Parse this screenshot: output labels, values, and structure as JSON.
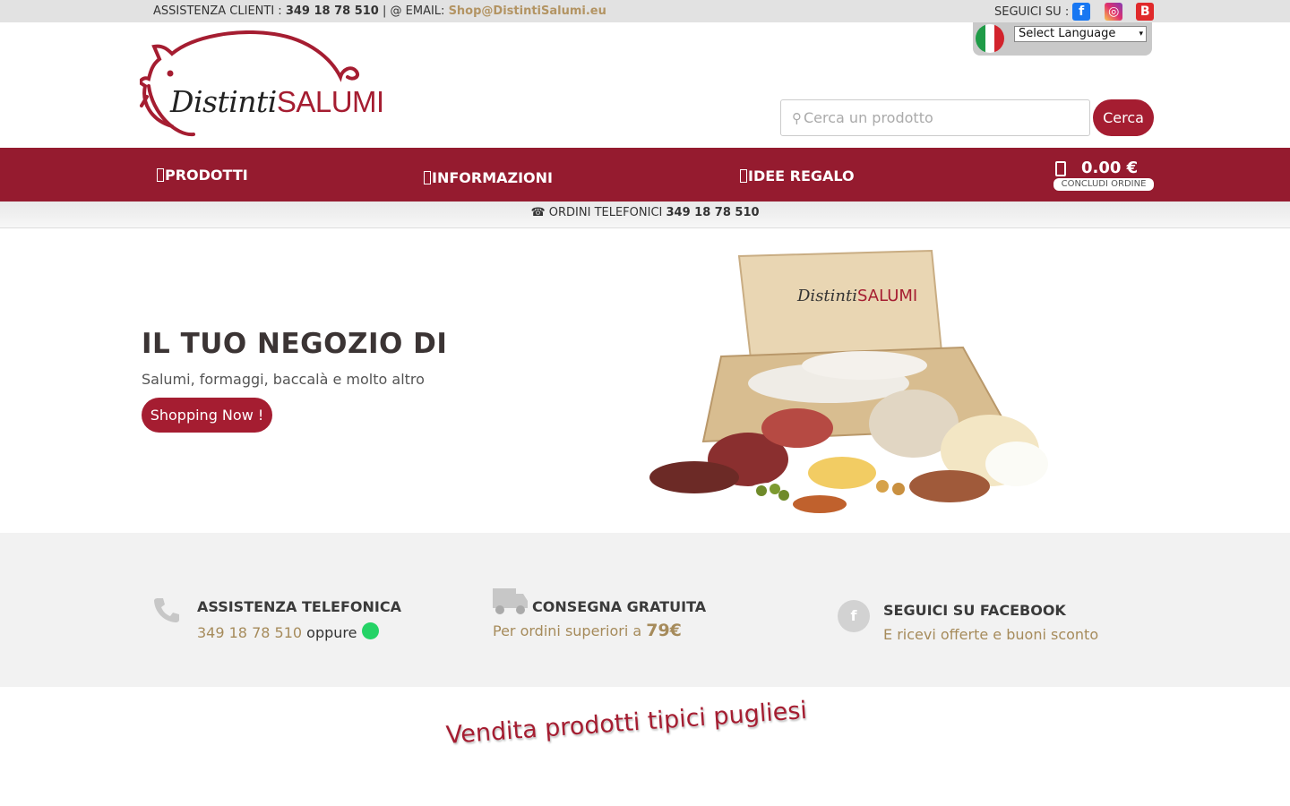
{
  "topbar": {
    "assist_label": " ASSISTENZA CLIENTI : ",
    "assist_phone": "349 18 78 510",
    "email_label": " | @ EMAIL: ",
    "email": "Shop@DistintiSalumi.eu",
    "follow_label": "SEGUICI SU :",
    "social": [
      "facebook-icon",
      "instagram-icon",
      "blogger-icon"
    ]
  },
  "language": {
    "select_value": "Select Language",
    "flag": "italy-flag"
  },
  "logo": {
    "word1": "Distinti",
    "word2": "SALUMI"
  },
  "search": {
    "placeholder": "Cerca un prodotto",
    "button": "Cerca"
  },
  "nav": {
    "items": [
      {
        "label": "PRODOTTI"
      },
      {
        "label": "INFORMAZIONI"
      },
      {
        "label": "IDEE REGALO"
      }
    ],
    "cart": {
      "amount": "0.00 €",
      "checkout": "CONCLUDI ORDINE"
    }
  },
  "strip": {
    "label": "☎ ORDINI TELEFONICI ",
    "phone": "349 18 78 510"
  },
  "hero": {
    "title": "IL TUO NEGOZIO DI",
    "subtitle": "Salumi, formaggi, baccalà e molto altro",
    "button": "Shopping Now !",
    "box_label_1": "Distinti",
    "box_label_2": "SALUMI"
  },
  "features": [
    {
      "title": "ASSISTENZA TELEFONICA",
      "phone": "349 18 78 510",
      "oppure": " oppure",
      "icon": "phone-icon"
    },
    {
      "title": "CONSEGNA GRATUITA",
      "desc": "Per ordini superiori a ",
      "amount": "79€",
      "icon": "truck-icon"
    },
    {
      "title": "SEGUICI SU FACEBOOK",
      "desc": "E ricevi offerte e buoni sconto",
      "icon": "facebook-icon"
    }
  ],
  "section_heading": "Vendita prodotti tipici pugliesi",
  "colors": {
    "brand": "#a51d31",
    "nav": "#951b2f",
    "gold": "#a68b5b"
  }
}
